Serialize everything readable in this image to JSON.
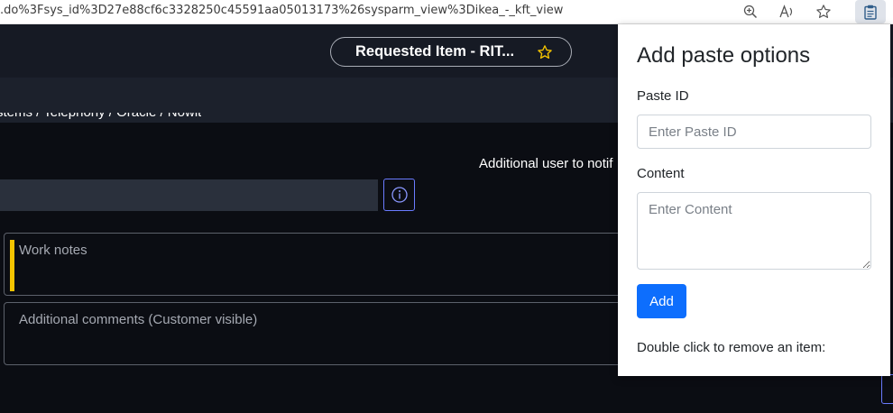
{
  "browser": {
    "url": ".do%3Fsys_id%3D27e88cf6c3328250c45591aa05013173%26sysparm_view%3Dikea_-_kft_view",
    "icons": [
      "zoom-icon",
      "read-aloud-icon",
      "favorite-star-icon",
      "clipboard-extension-icon"
    ]
  },
  "header": {
    "record_title": "Requested Item - RIT..."
  },
  "form": {
    "breadcrumb": "stems / Telephony / Oracle / Nowit",
    "additional_user_label": "Additional user to notif",
    "work_notes_label": "Work notes",
    "additional_comments_label": "Additional comments (Customer visible)"
  },
  "popup": {
    "title": "Add paste options",
    "paste_id_label": "Paste ID",
    "paste_id_placeholder": "Enter Paste ID",
    "content_label": "Content",
    "content_placeholder": "Enter Content",
    "add_button_label": "Add",
    "hint": "Double click to remove an item:"
  },
  "colors": {
    "accent": "#0d6efd",
    "work_notes_indicator": "#f5c400",
    "info_button_border": "#6a7bff"
  }
}
